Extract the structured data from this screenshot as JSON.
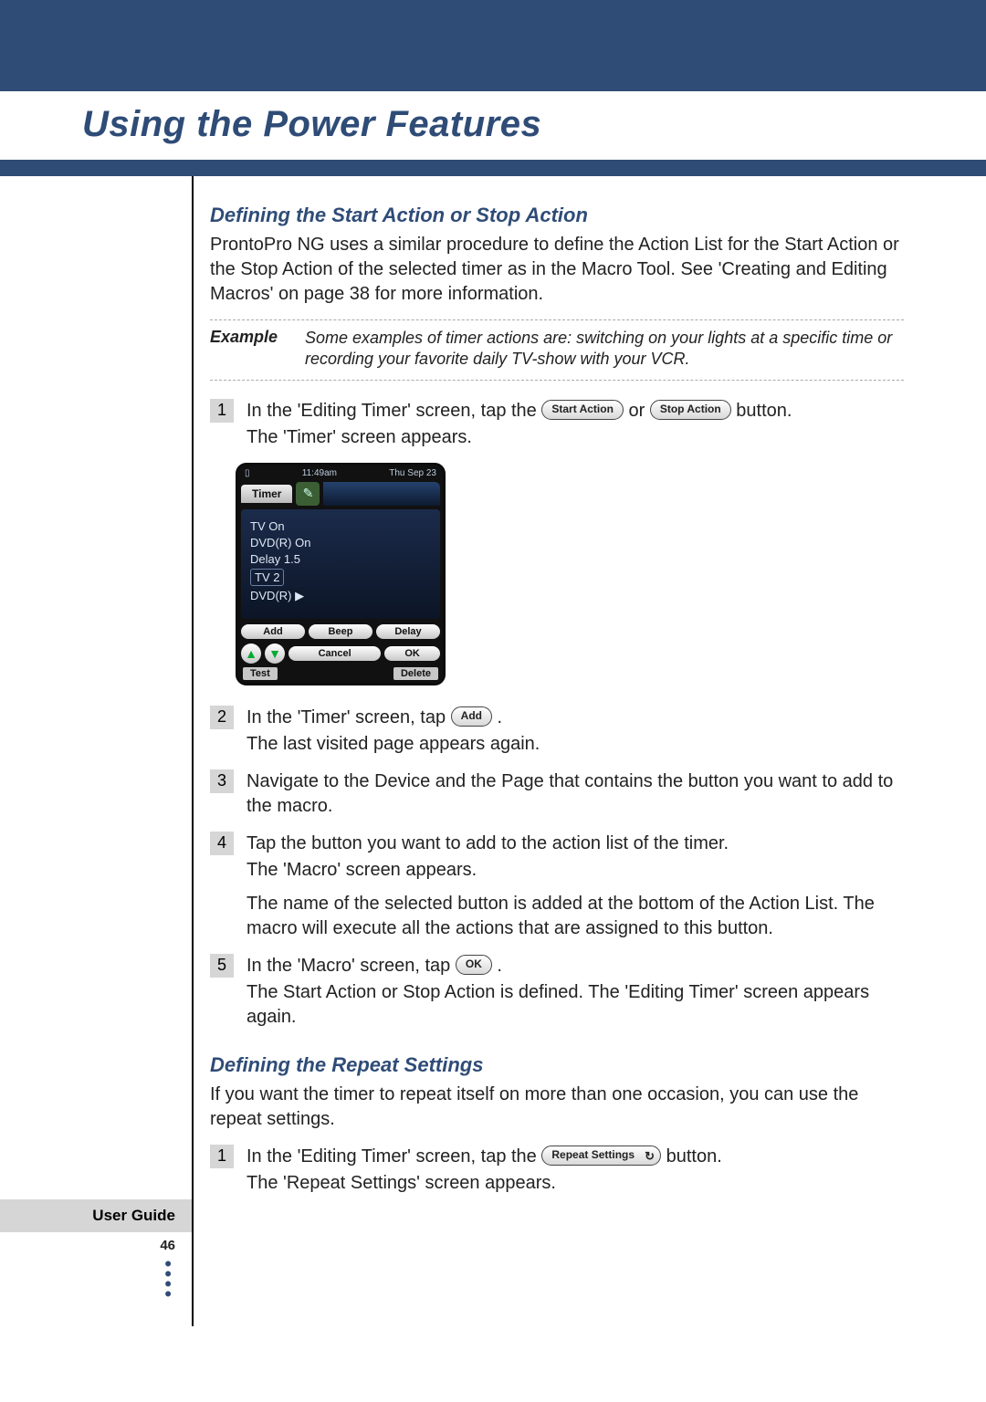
{
  "header": {
    "title": "Using the Power Features"
  },
  "section1": {
    "heading": "Defining the Start Action or Stop Action",
    "intro": "ProntoPro NG uses a similar procedure to define the Action List for the Start Action or the Stop Action of the selected timer as in the Macro Tool. See 'Creating and Editing Macros' on page 38 for more information."
  },
  "example": {
    "label": "Example",
    "text": "Some examples of timer actions are: switching on your lights at a specific time or recording your favorite daily TV-show with your VCR."
  },
  "step1": {
    "num": "1",
    "pre": "In the 'Editing Timer' screen, tap the ",
    "btn1": "Start Action",
    "mid": " or ",
    "btn2": "Stop Action",
    "post": " button.",
    "sub": "The 'Timer' screen appears."
  },
  "shot": {
    "battery": "▯",
    "time": "11:49am",
    "date": "Thu Sep 23",
    "tab": "Timer",
    "rows": [
      "TV On",
      "DVD(R) On",
      "Delay 1.5",
      "TV 2",
      "DVD(R) ▶"
    ],
    "btns": [
      "Add",
      "Beep",
      "Delay"
    ],
    "cancel": "Cancel",
    "ok": "OK",
    "foot_l": "Test",
    "foot_r": "Delete"
  },
  "step2": {
    "num": "2",
    "pre": "In the 'Timer' screen, tap ",
    "btn": "Add",
    "post": ".",
    "sub": "The last visited page appears again."
  },
  "step3": {
    "num": "3",
    "text": "Navigate to the Device and the Page that contains the button you want to add to the macro."
  },
  "step4": {
    "num": "4",
    "line1": "Tap the button you want to add to the action list of the timer.",
    "line2": "The 'Macro' screen appears.",
    "line3": "The name of the selected button is added at the bottom of the Action List. The macro will execute all the actions that are assigned to this button."
  },
  "step5": {
    "num": "5",
    "pre": "In the 'Macro' screen, tap ",
    "btn": "OK",
    "post": ".",
    "sub": "The Start Action or Stop Action is defined. The 'Editing Timer' screen appears again."
  },
  "section2": {
    "heading": "Defining the Repeat Settings",
    "intro": "If you want the timer to repeat itself on more than one occasion, you can use the repeat settings."
  },
  "step2_1": {
    "num": "1",
    "pre": "In the 'Editing Timer' screen, tap the ",
    "btn": "Repeat Settings",
    "icon": "↻",
    "post": " button.",
    "sub": "The 'Repeat Settings' screen appears."
  },
  "footer": {
    "label": "User Guide",
    "page": "46"
  }
}
